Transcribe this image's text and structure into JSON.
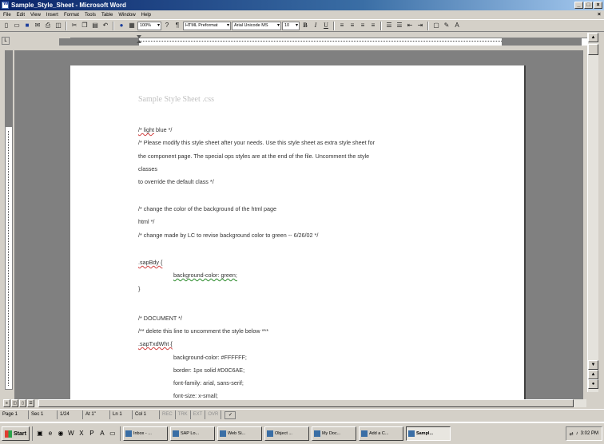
{
  "window": {
    "title": "Sample_Style_Sheet - Microsoft Word",
    "controls": [
      "_",
      "□",
      "×"
    ]
  },
  "menu": [
    "File",
    "Edit",
    "View",
    "Insert",
    "Format",
    "Tools",
    "Table",
    "Window",
    "Help"
  ],
  "toolbar": {
    "zoom": "100%",
    "style": "HTML Preformat",
    "font": "Arial Unicode MS",
    "size": "10",
    "bold": "B",
    "italic": "I",
    "underline": "U"
  },
  "document": {
    "title": "Sample Style Sheet .css",
    "lines": [
      "/* light blue */",
      "/*  Please modify this style sheet after your needs. Use this style sheet as extra style sheet for",
      "     the component page. The special ops styles are at the end of the file. Uncomment the style",
      "classes",
      "   to override the default class */",
      "/* change the color of the background of the html page",
      "   html */",
      "/* change made by LC to revise background color to green -- 6/26/02 */",
      ".sapBdy {",
      "background-color: green;",
      "}",
      "/* DOCUMENT  */",
      "/** delete this line to uncomment the style below ***",
      ".sapTxdWht {",
      "background-color: #FFFFFF;",
      "border: 1px solid #D0C6AE;",
      "font-family: arial, sans-serif;",
      "font-size: x-small;"
    ]
  },
  "status": {
    "page": "Page 1",
    "sec": "Sec 1",
    "pages": "1/24",
    "at": "At 1\"",
    "ln": "Ln 1",
    "col": "Col 1",
    "rec": "REC",
    "trk": "TRK",
    "ext": "EXT",
    "ovr": "OVR"
  },
  "taskbar": {
    "start": "Start",
    "tasks": [
      "Inbox - ...",
      "SAP Lo...",
      "Web Si...",
      "Object ...",
      "My Doc...",
      "Add a C...",
      "Sampl...",
      ""
    ],
    "clock": "3:02 PM"
  }
}
